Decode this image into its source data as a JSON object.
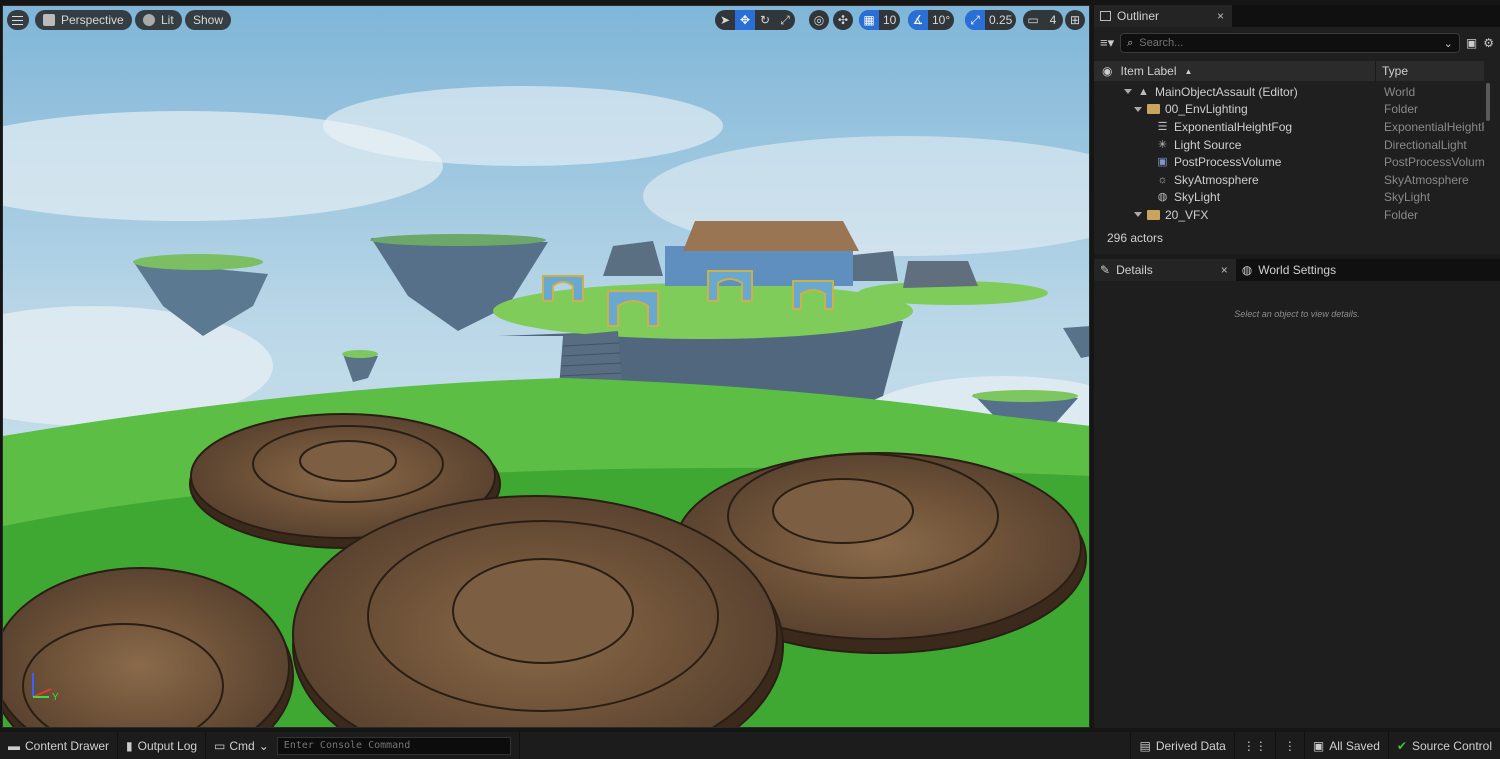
{
  "viewport": {
    "menu_icon": "hamburger-icon",
    "perspective_label": "Perspective",
    "lit_label": "Lit",
    "show_label": "Show",
    "grid_snap": "10",
    "rotation_snap": "10°",
    "scale_snap": "0.25",
    "camera_speed": "4",
    "accent": "#2a6fd6"
  },
  "outliner": {
    "tab_label": "Outliner",
    "close": "×",
    "search_placeholder": "Search...",
    "col_label": "Item Label",
    "col_type": "Type",
    "sort_indicator": "▲",
    "rows": [
      {
        "label": "MainObjectAssault (Editor)",
        "type": "World"
      },
      {
        "label": "00_EnvLighting",
        "type": "Folder"
      },
      {
        "label": "ExponentialHeightFog",
        "type": "ExponentialHeightF"
      },
      {
        "label": "Light Source",
        "type": "DirectionalLight"
      },
      {
        "label": "PostProcessVolume",
        "type": "PostProcessVolum"
      },
      {
        "label": "SkyAtmosphere",
        "type": "SkyAtmosphere"
      },
      {
        "label": "SkyLight",
        "type": "SkyLight"
      },
      {
        "label": "20_VFX",
        "type": "Folder"
      }
    ],
    "actor_count": "296 actors"
  },
  "details": {
    "tab_label": "Details",
    "close": "×",
    "world_settings_label": "World Settings",
    "empty_message": "Select an object to view details."
  },
  "statusbar": {
    "content_drawer": "Content Drawer",
    "output_log": "Output Log",
    "cmd": "Cmd",
    "console_placeholder": "Enter Console Command",
    "derived_data": "Derived Data",
    "all_saved": "All Saved",
    "source_control": "Source Control"
  },
  "axis": {
    "y_label": "Y"
  }
}
